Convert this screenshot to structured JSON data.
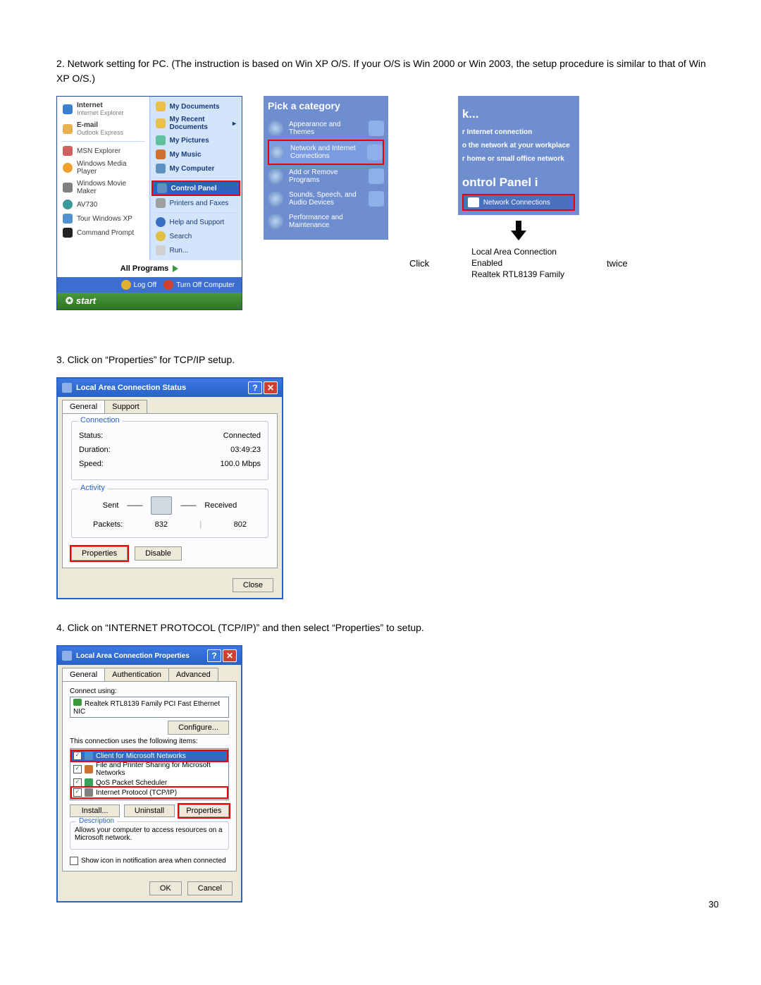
{
  "page_number": "30",
  "step2": {
    "num": "2.",
    "text": "Network setting for PC.  (The instruction is based on Win XP O/S. If your O/S is Win 2000 or Win 2003, the setup procedure is similar to that of Win XP O/S.)"
  },
  "start_menu": {
    "left": [
      {
        "l1": "Internet",
        "l2": "Internet Explorer"
      },
      {
        "l1": "E-mail",
        "l2": "Outlook Express"
      },
      {
        "l1": "MSN Explorer"
      },
      {
        "l1": "Windows Media Player"
      },
      {
        "l1": "Windows Movie Maker"
      },
      {
        "l1": "AV730"
      },
      {
        "l1": "Tour Windows XP"
      },
      {
        "l1": "Command Prompt"
      }
    ],
    "right": [
      "My Documents",
      "My Recent Documents",
      "My Pictures",
      "My Music",
      "My Computer",
      "Control Panel",
      "Printers and Faxes",
      "Help and Support",
      "Search",
      "Run..."
    ],
    "all_programs": "All Programs",
    "logoff": "Log Off",
    "turnoff": "Turn Off Computer",
    "start": "start"
  },
  "cp_cat": {
    "title": "Pick a category",
    "items": [
      "Appearance and Themes",
      "Network and Internet Connections",
      "Add or Remove Programs",
      "Sounds, Speech, and Audio Devices",
      "Performance and Maintenance"
    ]
  },
  "cp2": {
    "k": "k...",
    "lines": [
      "r Internet connection",
      "o the network at your workplace",
      "r home or small office network"
    ],
    "heading": "ontrol Panel i",
    "nc": "Network Connections"
  },
  "lac_click": {
    "click": "Click",
    "l1": "Local Area Connection",
    "l2": "Enabled",
    "l3": "Realtek RTL8139 Family",
    "twice": "twice"
  },
  "step3": {
    "num": "3.",
    "text": "Click on “Properties” for TCP/IP setup."
  },
  "status_dlg": {
    "title": "Local Area Connection Status",
    "tabs": {
      "general": "General",
      "support": "Support"
    },
    "connection": {
      "legend": "Connection",
      "status_k": "Status:",
      "status_v": "Connected",
      "duration_k": "Duration:",
      "duration_v": "03:49:23",
      "speed_k": "Speed:",
      "speed_v": "100.0 Mbps"
    },
    "activity": {
      "legend": "Activity",
      "sent": "Sent",
      "received": "Received",
      "packets_k": "Packets:",
      "sent_v": "832",
      "recv_v": "802"
    },
    "properties": "Properties",
    "disable": "Disable",
    "close": "Close"
  },
  "step4": {
    "num": "4.",
    "text": "Click on “INTERNET PROTOCOL (TCP/IP)” and then select “Properties” to setup."
  },
  "props_dlg": {
    "title": "Local Area Connection Properties",
    "tabs": {
      "general": "General",
      "auth": "Authentication",
      "adv": "Advanced"
    },
    "connect_using": "Connect using:",
    "nic": "Realtek RTL8139 Family PCI Fast Ethernet NIC",
    "configure": "Configure...",
    "uses_items": "This connection uses the following items:",
    "items": [
      "Client for Microsoft Networks",
      "File and Printer Sharing for Microsoft Networks",
      "QoS Packet Scheduler",
      "Internet Protocol (TCP/IP)"
    ],
    "install": "Install...",
    "uninstall": "Uninstall",
    "properties": "Properties",
    "desc_legend": "Description",
    "desc_text": "Allows your computer to access resources on a Microsoft network.",
    "show_icon": "Show icon in notification area when connected",
    "ok": "OK",
    "cancel": "Cancel"
  }
}
